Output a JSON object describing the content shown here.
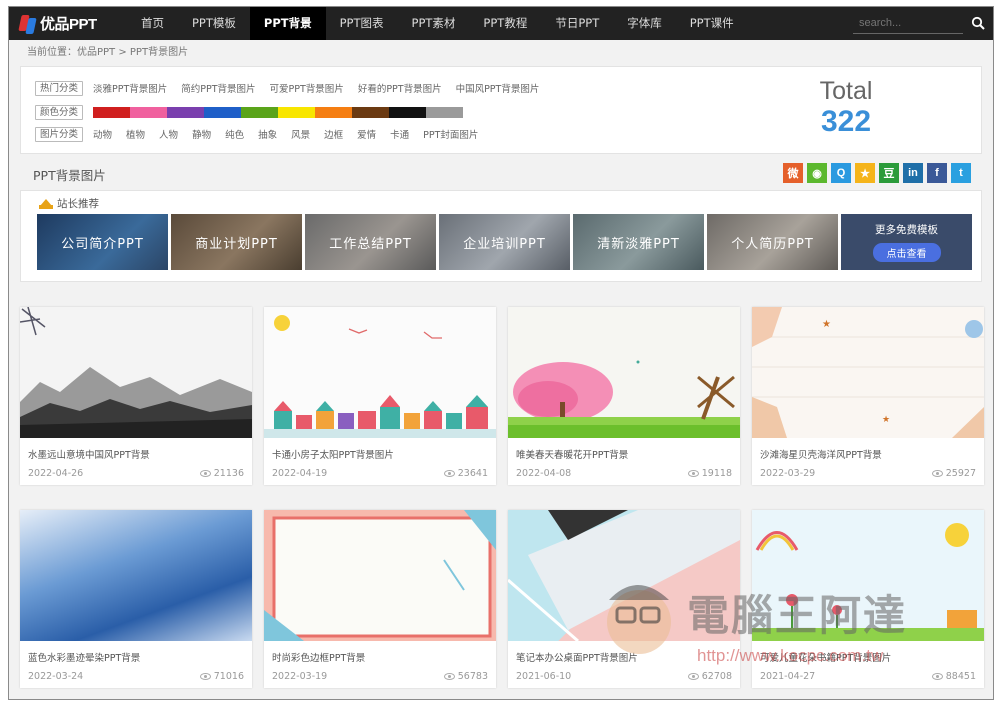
{
  "nav": {
    "logo_text": "优品PPT",
    "items": [
      "首页",
      "PPT模板",
      "PPT背景",
      "PPT图表",
      "PPT素材",
      "PPT教程",
      "节日PPT",
      "字体库",
      "PPT课件"
    ],
    "active_index": 2,
    "search_placeholder": "search..."
  },
  "breadcrumb": "当前位置：优品PPT > PPT背景图片",
  "filters": {
    "hot_label": "热门分类",
    "hot_links": [
      "淡雅PPT背景图片",
      "简约PPT背景图片",
      "可爱PPT背景图片",
      "好看的PPT背景图片",
      "中国风PPT背景图片"
    ],
    "color_label": "颜色分类",
    "colors": [
      "#d01f1f",
      "#f0609e",
      "#7a3fae",
      "#1f5fc8",
      "#5aa41a",
      "#f8e600",
      "#f57e12",
      "#6b3a12",
      "#111111",
      "#9a9a9a"
    ],
    "type_label": "图片分类",
    "type_links": [
      "动物",
      "植物",
      "人物",
      "静物",
      "纯色",
      "抽象",
      "风景",
      "边框",
      "爱情",
      "卡通",
      "PPT封面图片"
    ]
  },
  "total": {
    "label": "Total",
    "value": "322"
  },
  "section_title": "PPT背景图片",
  "share": [
    {
      "icon": "weibo-icon",
      "glyph": "微",
      "color": "#e5602b"
    },
    {
      "icon": "wechat-icon",
      "glyph": "◉",
      "color": "#5cb82e"
    },
    {
      "icon": "qq-icon",
      "glyph": "Q",
      "color": "#2a9ae0"
    },
    {
      "icon": "star-icon",
      "glyph": "★",
      "color": "#f5b41a"
    },
    {
      "icon": "douban-icon",
      "glyph": "豆",
      "color": "#2b9b3a"
    },
    {
      "icon": "linkedin-icon",
      "glyph": "in",
      "color": "#1f6fa8"
    },
    {
      "icon": "facebook-icon",
      "glyph": "f",
      "color": "#3b5998"
    },
    {
      "icon": "twitter-icon",
      "glyph": "t",
      "color": "#2aa0e0"
    }
  ],
  "recommend": {
    "title": "站长推荐",
    "cards": [
      "公司简介PPT",
      "商业计划PPT",
      "工作总结PPT",
      "企业培训PPT",
      "清新淡雅PPT",
      "个人简历PPT"
    ],
    "more_top": "更多免费模板",
    "more_btn": "点击查看"
  },
  "items": [
    {
      "title": "水墨远山意境中国风PPT背景",
      "date": "2022-04-26",
      "views": "21136"
    },
    {
      "title": "卡通小房子太阳PPT背景图片",
      "date": "2022-04-19",
      "views": "23641"
    },
    {
      "title": "唯美春天春暖花开PPT背景",
      "date": "2022-04-08",
      "views": "19118"
    },
    {
      "title": "沙滩海星贝壳海洋风PPT背景",
      "date": "2022-03-29",
      "views": "25927"
    },
    {
      "title": "蓝色水彩墨迹晕染PPT背景",
      "date": "2022-03-24",
      "views": "71016"
    },
    {
      "title": "时尚彩色边框PPT背景",
      "date": "2022-03-19",
      "views": "56783"
    },
    {
      "title": "笔记本办公桌面PPT背景图片",
      "date": "2021-06-10",
      "views": "62708"
    },
    {
      "title": "可爱儿童花朵书籍PPT背景图片",
      "date": "2021-04-27",
      "views": "88451"
    }
  ],
  "watermark": {
    "text": "電腦王阿達",
    "url": "http://www.kocpc.com.tw"
  }
}
